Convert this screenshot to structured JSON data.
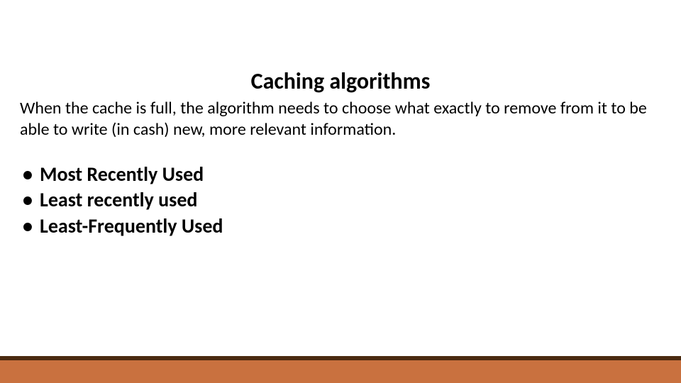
{
  "slide": {
    "title": "Caching algorithms",
    "description": "When the cache is full, the algorithm needs to choose what exactly to remove from it to be able to write (in cash) new, more relevant information.",
    "bullets": [
      "Most Recently Used",
      "Least recently used",
      "Least-Frequently Used"
    ]
  },
  "colors": {
    "footerTop": "#4a2a10",
    "footerBottom": "#c9713f"
  }
}
